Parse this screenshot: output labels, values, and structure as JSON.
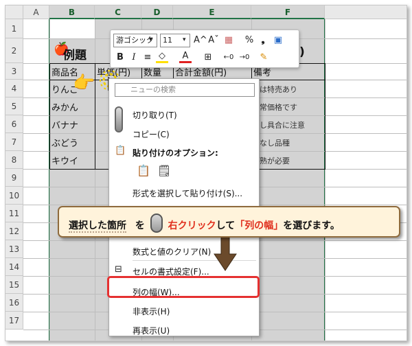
{
  "sheet": {
    "columns": [
      "A",
      "B",
      "C",
      "D",
      "E",
      "F"
    ],
    "rows": [
      "1",
      "2",
      "3",
      "4",
      "5",
      "6",
      "7",
      "8",
      "9",
      "10",
      "11",
      "12",
      "13",
      "14",
      "15",
      "16",
      "17"
    ]
  },
  "table": {
    "title": "例題",
    "title_tail": ")",
    "headers": [
      "商品名",
      "単価(円)",
      "数量",
      "合計金額(円)",
      "備考"
    ],
    "items": [
      "りんご",
      "みかん",
      "バナナ",
      "ぶどう",
      "キウイ"
    ],
    "notes": [
      "は特売あり",
      "常価格です",
      "し具合に注意",
      "なし品種",
      "熟が必要"
    ]
  },
  "mini_toolbar": {
    "font_name": "游ゴシック",
    "font_size": "11",
    "row1_icons": [
      "A^",
      "Aˇ",
      "%",
      "❟"
    ],
    "row2_labels": [
      "B",
      "I"
    ]
  },
  "context_menu": {
    "search_placeholder": "ニューの検索",
    "cut": "切り取り(T)",
    "copy": "コピー(C)",
    "paste_options": "貼り付けのオプション:",
    "paste_special": "形式を選択して貼り付け(S)...",
    "clear": "数式と値のクリア(N)",
    "format_cells": "セルの書式設定(F)...",
    "column_width": "列の幅(W)...",
    "hide": "非表示(H)",
    "unhide": "再表示(U)"
  },
  "callout": {
    "part1": "選択した箇所",
    "part2": "を",
    "part3": "右クリック",
    "part4": "して",
    "part5": "「列の幅」",
    "part6": "を選びます。"
  },
  "colors": {
    "selection_green": "#217346",
    "highlight_red": "#e53131",
    "callout_bg": "#fff3db"
  }
}
